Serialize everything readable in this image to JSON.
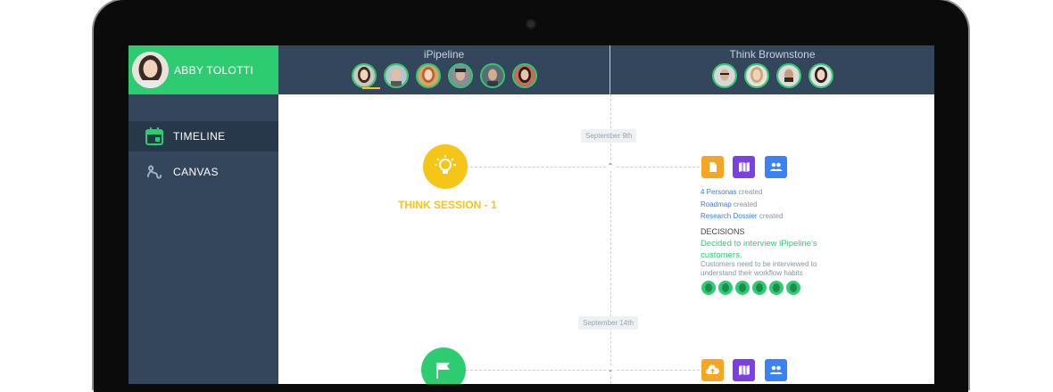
{
  "user": {
    "name": "ABBY TOLOTTI"
  },
  "nav": [
    {
      "label": "TIMELINE",
      "icon": "calendar-icon",
      "active": true
    },
    {
      "label": "CANVAS",
      "icon": "squiggle-icon",
      "active": false
    }
  ],
  "teams": [
    {
      "name": "iPipeline",
      "member_count": 6
    },
    {
      "name": "Think Brownstone",
      "member_count": 4
    }
  ],
  "timeline": {
    "entries": [
      {
        "date": "September 9th",
        "session_title": "THINK SESSION - 1",
        "session_icon": "lightbulb-icon",
        "artifacts": [
          {
            "icon": "document-icon",
            "color": "#f5a623"
          },
          {
            "icon": "map-icon",
            "color": "#7b3fe4"
          },
          {
            "icon": "people-icon",
            "color": "#3b82f6"
          }
        ],
        "created": [
          {
            "link": "4 Personas",
            "suffix": "created"
          },
          {
            "link": "Roadmap",
            "suffix": "created"
          },
          {
            "link": "Research Dossier",
            "suffix": "created"
          }
        ],
        "decisions_heading": "DECISIONS",
        "decision": "Decided to interview iPipeline's customers.",
        "decision_note": "Customers need to be interviewed to understand their workflow habits",
        "participant_count": 6
      },
      {
        "date": "September 14th",
        "session_icon": "flag-icon",
        "artifacts": [
          {
            "icon": "cloud-upload-icon",
            "color": "#f5a623"
          },
          {
            "icon": "map-icon",
            "color": "#7b3fe4"
          },
          {
            "icon": "people-icon",
            "color": "#3b82f6"
          }
        ]
      }
    ]
  },
  "colors": {
    "accent_green": "#2ecc71",
    "sidebar": "#34465c",
    "yellow": "#f5c518"
  }
}
